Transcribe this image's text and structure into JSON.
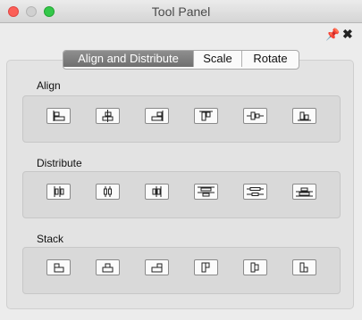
{
  "window": {
    "title": "Tool Panel"
  },
  "toolbar": {
    "pin_icon": "pin-icon",
    "close_icon": "close-icon"
  },
  "tabs": [
    {
      "label": "Align and Distribute",
      "active": true
    },
    {
      "label": "Scale",
      "active": false
    },
    {
      "label": "Rotate",
      "active": false
    }
  ],
  "sections": {
    "align": {
      "label": "Align",
      "buttons": [
        "align-left-icon",
        "align-center-horizontal-icon",
        "align-right-icon",
        "align-top-icon",
        "align-center-vertical-icon",
        "align-bottom-icon"
      ]
    },
    "distribute": {
      "label": "Distribute",
      "buttons": [
        "distribute-left-icon",
        "distribute-center-horizontal-icon",
        "distribute-right-icon",
        "distribute-top-icon",
        "distribute-center-vertical-icon",
        "distribute-bottom-icon"
      ]
    },
    "stack": {
      "label": "Stack",
      "buttons": [
        "stack-left-icon",
        "stack-center-icon",
        "stack-right-icon",
        "stack-top-icon",
        "stack-middle-icon",
        "stack-bottom-icon"
      ]
    }
  }
}
